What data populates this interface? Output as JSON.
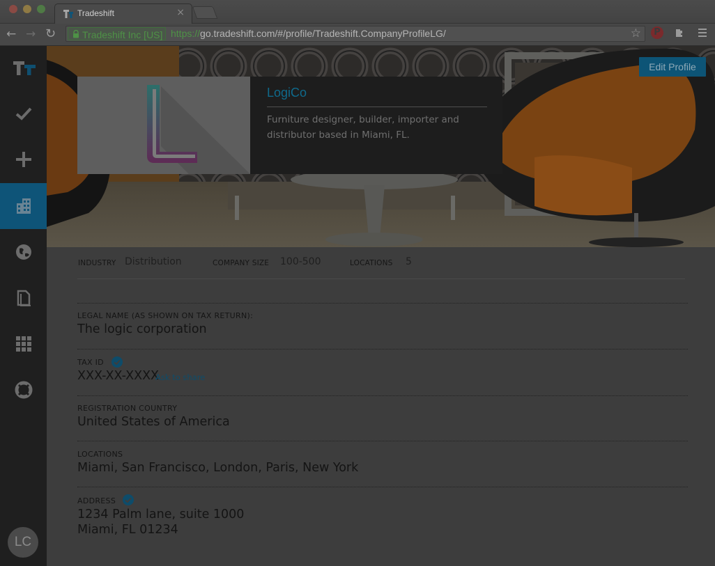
{
  "browser": {
    "tab_title": "Tradeshift",
    "tab_close": "×",
    "ev_label": "Tradeshift Inc [US]",
    "url_scheme": "https://",
    "url_rest": "go.tradeshift.com/#/profile/Tradeshift.CompanyProfileLG/",
    "nav_back": "←",
    "nav_forward": "→",
    "nav_reload": "↻",
    "star": "☆",
    "pinterest": "P"
  },
  "rail": {
    "items": [
      "tasks-icon",
      "create-icon",
      "company-profile-icon",
      "network-icon",
      "documents-icon",
      "apps-icon",
      "help-icon"
    ],
    "active": "company-profile-icon",
    "user_initials": "LC"
  },
  "hero": {
    "edit_label": "Edit Profile"
  },
  "company": {
    "name": "LogiCo",
    "description": "Furniture designer, builder, importer and distributor based in Miami, FL."
  },
  "stats": {
    "industry_label": "INDUSTRY",
    "industry_value": "Distribution",
    "size_label": "COMPANY SIZE",
    "size_value": "100-500",
    "locations_label": "LOCATIONS",
    "locations_value": "5"
  },
  "fields": {
    "legal_name_label": "LEGAL NAME (AS SHOWN ON TAX RETURN):",
    "legal_name_value": "The logic corporation",
    "tax_id_label": "TAX ID",
    "tax_id_value": "XXX-XX-XXXX",
    "tax_id_link": "Ask to share",
    "country_label": "REGISTRATION COUNTRY",
    "country_value": "United States of America",
    "locations_label": "LOCATIONS",
    "locations_value": "Miami, San Francisco, London, Paris, New York",
    "address_label": "ADDRESS",
    "address_line1": "1234 Palm lane, suite 1000",
    "address_line2": "Miami, FL 01234"
  },
  "colors": {
    "accent": "#0e5478",
    "link": "#0e4c6a",
    "rail_bg": "#1f1f1f",
    "overlay_dim": "#3d3d3d"
  }
}
